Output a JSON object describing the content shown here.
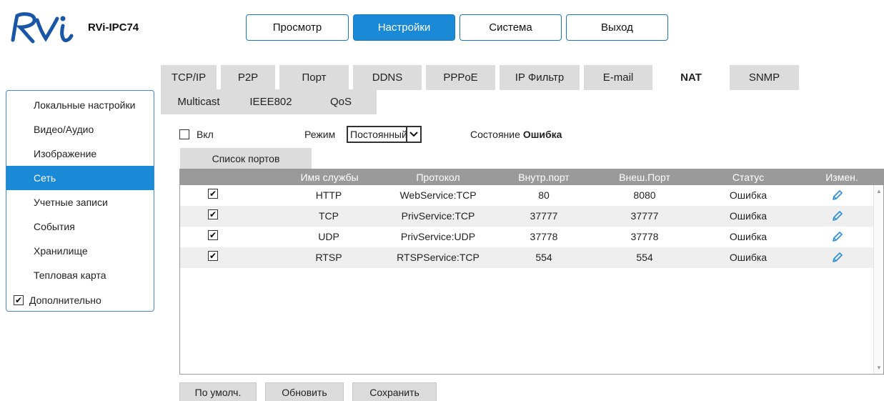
{
  "header": {
    "logo_text": "RVi",
    "model": "RVi-IPC74",
    "nav": [
      {
        "label": "Просмотр",
        "active": false
      },
      {
        "label": "Настройки",
        "active": true
      },
      {
        "label": "Система",
        "active": false
      },
      {
        "label": "Выход",
        "active": false
      }
    ]
  },
  "sidebar": {
    "items": [
      {
        "label": "Локальные настройки",
        "active": false
      },
      {
        "label": "Видео/Аудио",
        "active": false
      },
      {
        "label": "Изображение",
        "active": false
      },
      {
        "label": "Сеть",
        "active": true
      },
      {
        "label": "Учетные записи",
        "active": false
      },
      {
        "label": "События",
        "active": false
      },
      {
        "label": "Хранилище",
        "active": false
      },
      {
        "label": "Тепловая карта",
        "active": false
      }
    ],
    "extra": {
      "label": "Дополнительно",
      "checked": true
    }
  },
  "tabs": {
    "row1": [
      "TCP/IP",
      "P2P",
      "Порт",
      "DDNS",
      "PPPoE",
      "IP Фильтр",
      "E-mail",
      "NAT",
      "SNMP"
    ],
    "row2": [
      "Multicast",
      "IEEE802",
      "QoS"
    ],
    "active": "NAT"
  },
  "form": {
    "enable_label": "Вкл",
    "enable_checked": false,
    "mode_label": "Режим",
    "mode_value": "Постоянный",
    "state_label": "Состояние",
    "state_value": "Ошибка"
  },
  "port_list": {
    "tab_label": "Список портов",
    "columns": [
      "Имя службы",
      "Протокол",
      "Внутр.порт",
      "Внеш.Порт",
      "Статус",
      "Измен."
    ],
    "rows": [
      {
        "checked": true,
        "service": "HTTP",
        "protocol": "WebService:TCP",
        "internal": "80",
        "external": "8080",
        "status": "Ошибка"
      },
      {
        "checked": true,
        "service": "TCP",
        "protocol": "PrivService:TCP",
        "internal": "37777",
        "external": "37777",
        "status": "Ошибка"
      },
      {
        "checked": true,
        "service": "UDP",
        "protocol": "PrivService:UDP",
        "internal": "37778",
        "external": "37778",
        "status": "Ошибка"
      },
      {
        "checked": true,
        "service": "RTSP",
        "protocol": "RTSPService:TCP",
        "internal": "554",
        "external": "554",
        "status": "Ошибка"
      }
    ]
  },
  "buttons": {
    "default": "По умолч.",
    "refresh": "Обновить",
    "save": "Сохранить"
  },
  "colors": {
    "accent": "#1a8ad6",
    "tab_bg": "#dcdcdc",
    "header_bg": "#9a9a9a",
    "logo": "#1a56a6",
    "edit_icon": "#2a8fd8"
  }
}
